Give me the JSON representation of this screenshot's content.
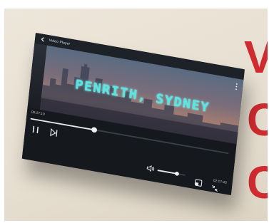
{
  "header": {
    "title": "Video Player",
    "back_icon": "back-chevron-icon"
  },
  "video": {
    "title": "PENRITH, SYDNEY",
    "more_icon": "more-vertical-icon"
  },
  "playback": {
    "current_time": "00:17:10",
    "total_time": "02:17:43",
    "progress": 0.32,
    "volume": 0.7
  },
  "controls": {
    "pause_icon": "pause-icon",
    "next_icon": "skip-next-icon",
    "volume_icon": "speaker-icon",
    "screen_icon": "screen-mode-icon",
    "shrink_icon": "exit-fullscreen-icon"
  },
  "background_text": [
    "V",
    "C",
    "C"
  ],
  "colors": {
    "accent_text": "#cf2b30",
    "title_glow": "#56e6e2",
    "player_bg": "#16191f"
  }
}
